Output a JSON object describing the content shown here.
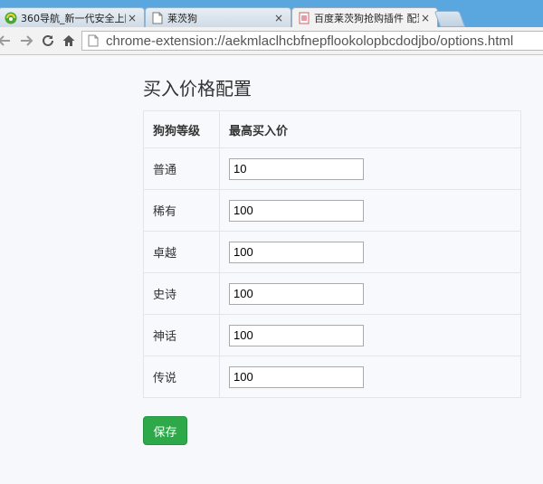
{
  "browser": {
    "tabs": [
      {
        "label": "360导航_新一代安全上网",
        "icon": "360-browser-icon"
      },
      {
        "label": "莱茨狗",
        "icon": "page-icon"
      },
      {
        "label": "百度莱茨狗抢购插件 配置",
        "icon": "extension-page-icon"
      }
    ],
    "close_glyph": "×",
    "address": "chrome-extension://aekmlaclhcbfnepflookolopbcdodjbo/options.html"
  },
  "page": {
    "title": "买入价格配置",
    "table": {
      "headers": [
        "狗狗等级",
        "最高买入价"
      ],
      "rows": [
        {
          "level": "普通",
          "price": "10"
        },
        {
          "level": "稀有",
          "price": "100"
        },
        {
          "level": "卓越",
          "price": "100"
        },
        {
          "level": "史诗",
          "price": "100"
        },
        {
          "level": "神话",
          "price": "100"
        },
        {
          "level": "传说",
          "price": "100"
        }
      ]
    },
    "save_label": "保存"
  },
  "colors": {
    "save_button": "#2ea94a",
    "tabstrip": "#5aa7df"
  }
}
